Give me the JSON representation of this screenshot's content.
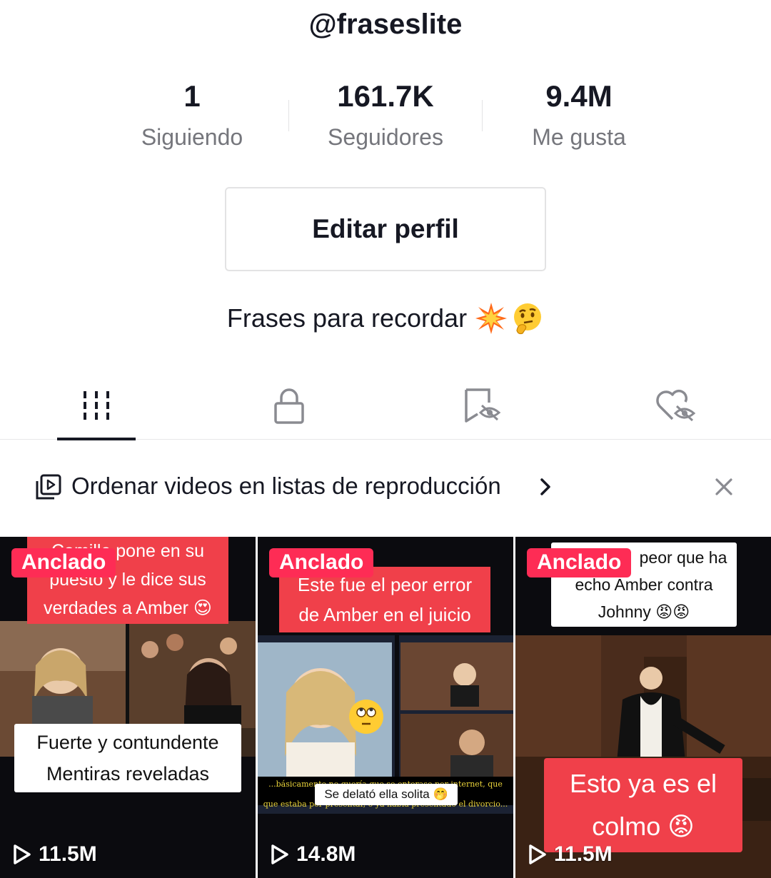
{
  "profile": {
    "username": "@fraseslite",
    "bio": "Frases para recordar"
  },
  "stats": [
    {
      "value": "1",
      "label": "Siguiendo"
    },
    {
      "value": "161.7K",
      "label": "Seguidores"
    },
    {
      "value": "9.4M",
      "label": "Me gusta"
    }
  ],
  "edit_button": "Editar perfil",
  "tabs": [
    {
      "icon": "grid-icon",
      "active": true
    },
    {
      "icon": "lock-icon",
      "active": false
    },
    {
      "icon": "hidden-tag-icon",
      "active": false
    },
    {
      "icon": "hidden-heart-icon",
      "active": false
    }
  ],
  "playlist_banner": {
    "icon": "playlist-icon",
    "text": "Ordenar videos en listas de reproducción"
  },
  "colors": {
    "accent": "#fe2c55",
    "text_primary": "#161823",
    "text_secondary": "#75767c"
  },
  "videos": [
    {
      "badge": "Anclado",
      "caption_top": [
        "Camille pone en su",
        "puesto y le dice sus",
        "verdades a Amber"
      ],
      "caption_bottom": [
        "Fuerte y contundente",
        "Mentiras reveladas"
      ],
      "views": "11.5M"
    },
    {
      "badge": "Anclado",
      "caption_top": [
        "Este fue el peor error",
        "de Amber en el juicio"
      ],
      "subtitle": [
        "...básicamente no quería que se enterase por internet, que tenía",
        "que estaba por presentar, o ya había presentado el divorcio..."
      ],
      "caption_bottom": [
        "Se delató ella solita"
      ],
      "views": "14.8M"
    },
    {
      "badge": "Anclado",
      "caption_top": [
        "peor que ha",
        "echo Amber contra",
        "Johnny"
      ],
      "caption_bottom": [
        "Esto ya es el",
        "colmo"
      ],
      "views": "11.5M"
    }
  ]
}
